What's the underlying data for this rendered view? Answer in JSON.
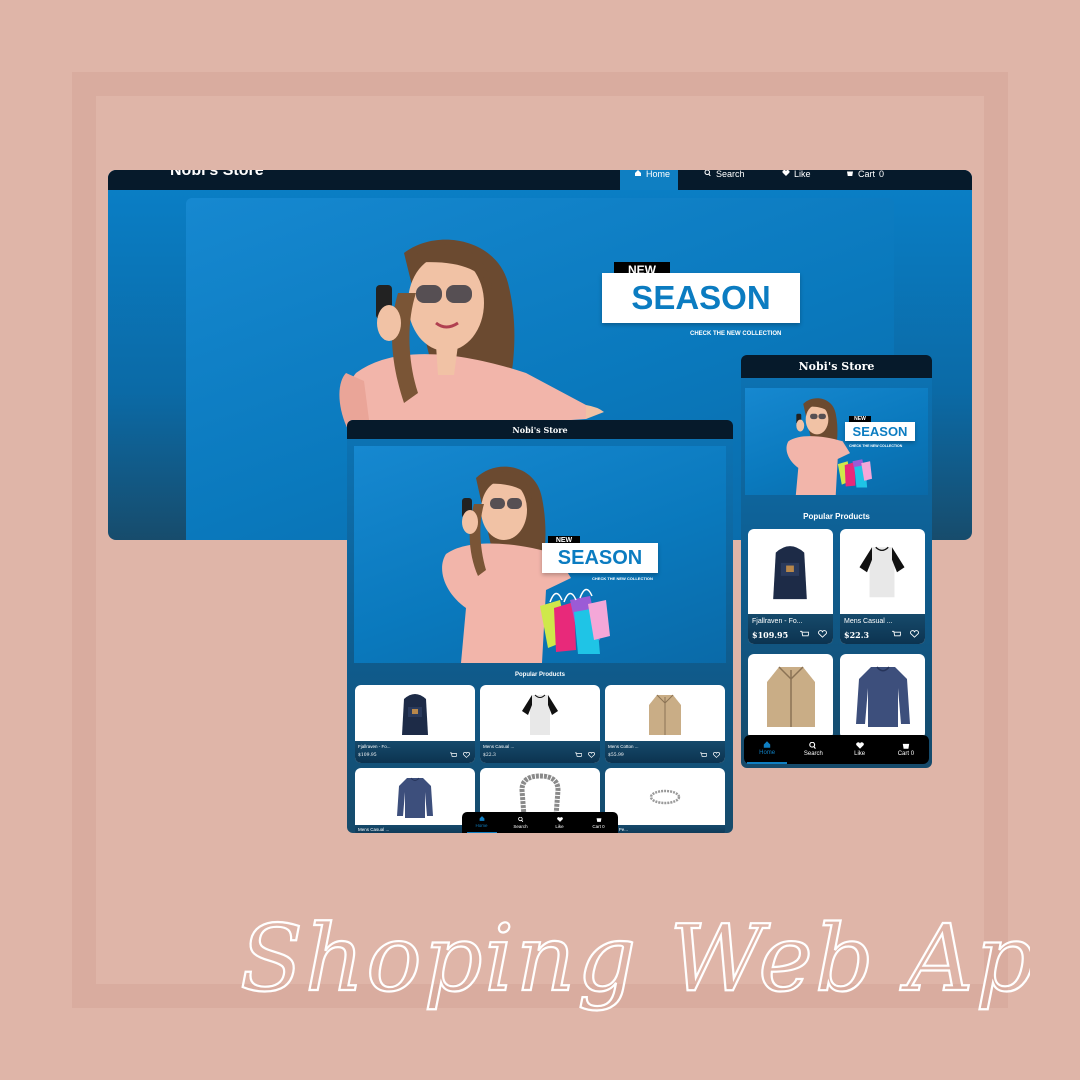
{
  "store_name": "Nobi's Store",
  "nav": {
    "home": "Home",
    "search": "Search",
    "like": "Like",
    "cart": "Cart"
  },
  "cart_badge": "0",
  "hero": {
    "tag": "NEW",
    "headline": "SEASON",
    "subline": "CHECK THE NEW COLLECTION"
  },
  "section_title": "Popular Products",
  "tablet_products": [
    {
      "name": "Fjallraven - Fo...",
      "price": "$109.95",
      "image": "backpack"
    },
    {
      "name": "Mens Casual ...",
      "price": "$22.3",
      "image": "raglan-tshirt"
    },
    {
      "name": "Mens Cotton ...",
      "price": "$55.99",
      "image": "jacket"
    },
    {
      "name": "Mens Casual ...",
      "price": "",
      "image": "long-sleeve-shirt"
    },
    {
      "name": "",
      "price": "",
      "image": "dragon-bracelet"
    },
    {
      "name": "Gold Pe...",
      "price": "",
      "image": "silver-ring"
    }
  ],
  "phone_products": [
    {
      "name": "Fjallraven - Fo...",
      "price": "$109.95",
      "image": "backpack"
    },
    {
      "name": "Mens Casual ...",
      "price": "$22.3",
      "image": "raglan-tshirt"
    },
    {
      "name": "",
      "price": "",
      "image": "jacket"
    },
    {
      "name": "",
      "price": "",
      "image": "long-sleeve-shirt"
    }
  ],
  "headline_text": "Shoping Web App",
  "colors": {
    "background": "#dfb5a8",
    "frame": "#d9ac9f",
    "navbar": "#061a2b",
    "hero_blue": "#0b7cc1",
    "accent": "#0f7fc2"
  }
}
